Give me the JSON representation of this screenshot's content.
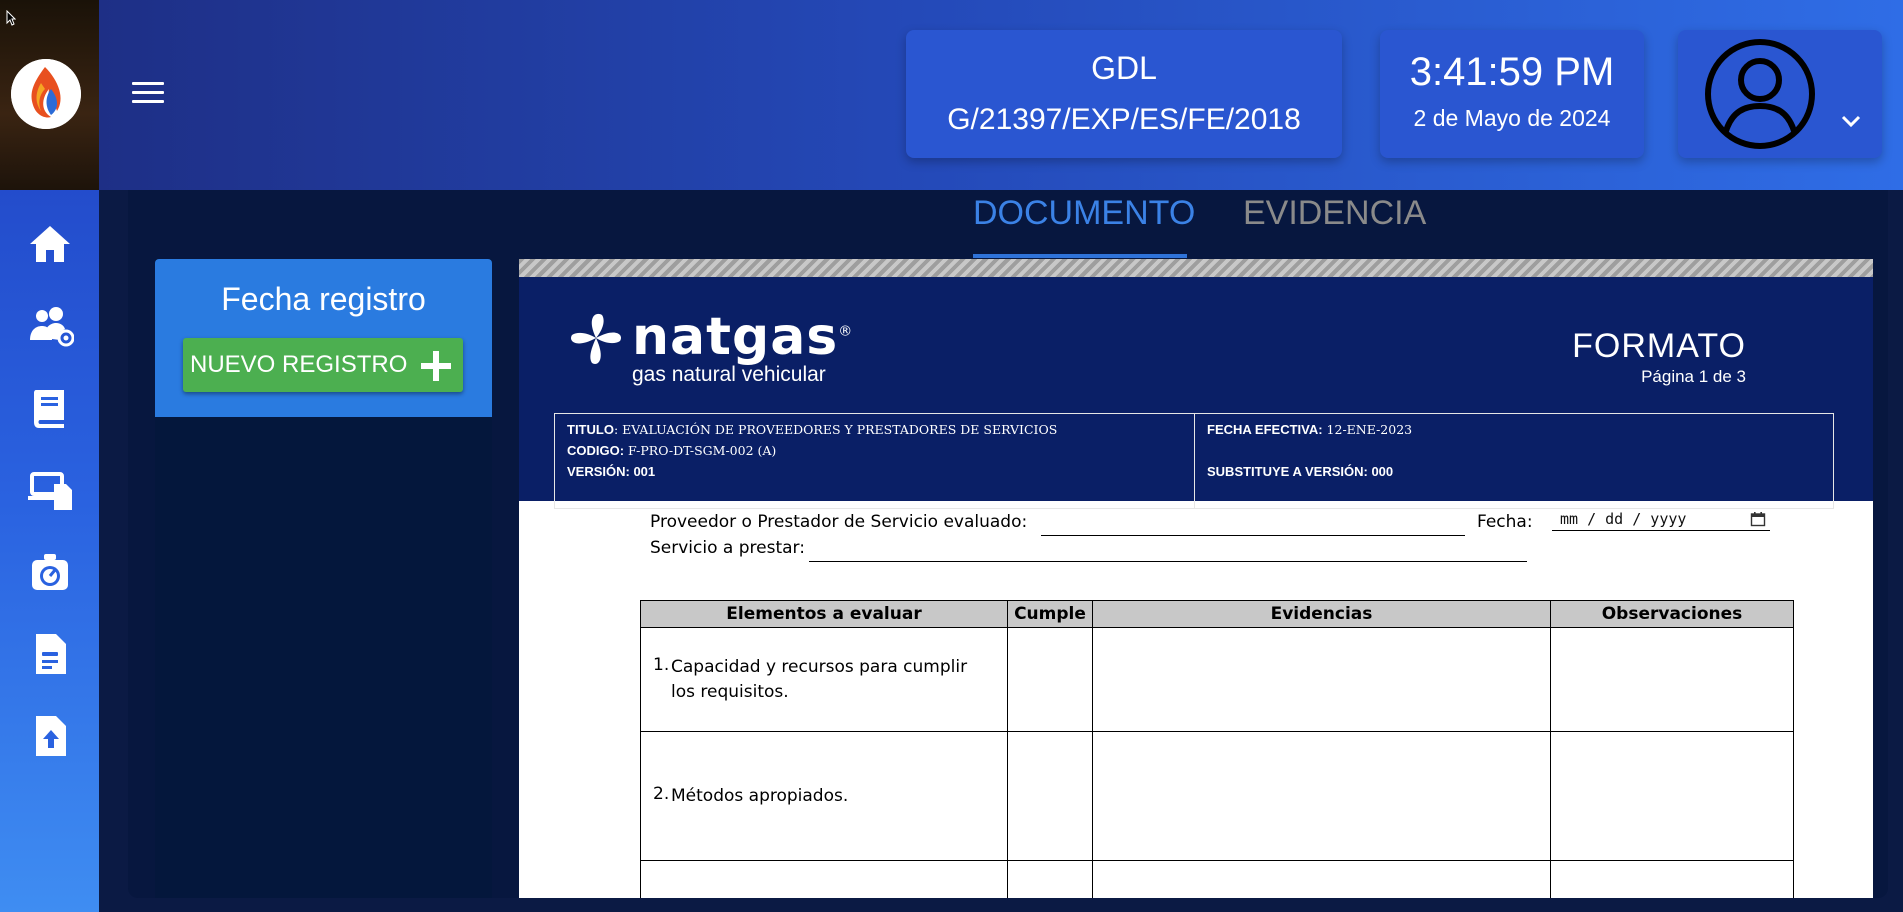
{
  "header": {
    "site": "GDL",
    "permit": "G/21397/EXP/ES/FE/2018",
    "time": "3:41:59 PM",
    "date": "2 de Mayo de 2024"
  },
  "sidebar": {
    "items": [
      {
        "icon": "home-icon"
      },
      {
        "icon": "users-settings-icon"
      },
      {
        "icon": "book-icon"
      },
      {
        "icon": "devices-icon"
      },
      {
        "icon": "gauge-icon"
      },
      {
        "icon": "document-icon"
      },
      {
        "icon": "file-upload-icon"
      }
    ]
  },
  "tabs": [
    {
      "label": "DOCUMENTO",
      "active": true
    },
    {
      "label": "EVIDENCIA",
      "active": false
    }
  ],
  "left_panel": {
    "title": "Fecha registro",
    "new_button": "NUEVO REGISTRO"
  },
  "document": {
    "brand_name": "natgas",
    "brand_registered": "®",
    "brand_tagline": "gas natural vehicular",
    "format_title": "FORMATO",
    "page_info": "Página 1 de 3",
    "meta": {
      "titulo_label": "TITULO",
      "titulo_value": ": EVALUACIÓN DE PROVEEDORES Y PRESTADORES DE SERVICIOS",
      "codigo_label": "CODIGO:",
      "codigo_value": " F-PRO-DT-SGM-002 (A)",
      "version_label": "VERSIÓN: 001",
      "fecha_efectiva_label": "FECHA EFECTIVA:",
      "fecha_efectiva_value": " 12-ENE-2023",
      "substituye_label": "SUBSTITUYE A VERSIÓN: 000"
    },
    "form": {
      "proveedor_label": "Proveedor o Prestador de Servicio evaluado:",
      "fecha_label": "Fecha:",
      "fecha_placeholder": "mm / dd / yyyy",
      "servicio_label": "Servicio a prestar:"
    },
    "table": {
      "headers": [
        "Elementos a evaluar",
        "Cumple",
        "Evidencias",
        "Observaciones"
      ],
      "rows": [
        {
          "num": "1.",
          "text": "Capacidad y recursos para cumplir los requisitos."
        },
        {
          "num": "2.",
          "text": "Métodos apropiados."
        }
      ]
    }
  },
  "colors": {
    "accent": "#2f73d9",
    "sidebar": "#2a62e0",
    "header": "#2449b8",
    "new_button": "#4caf50",
    "doc_header": "#0a1f66"
  }
}
